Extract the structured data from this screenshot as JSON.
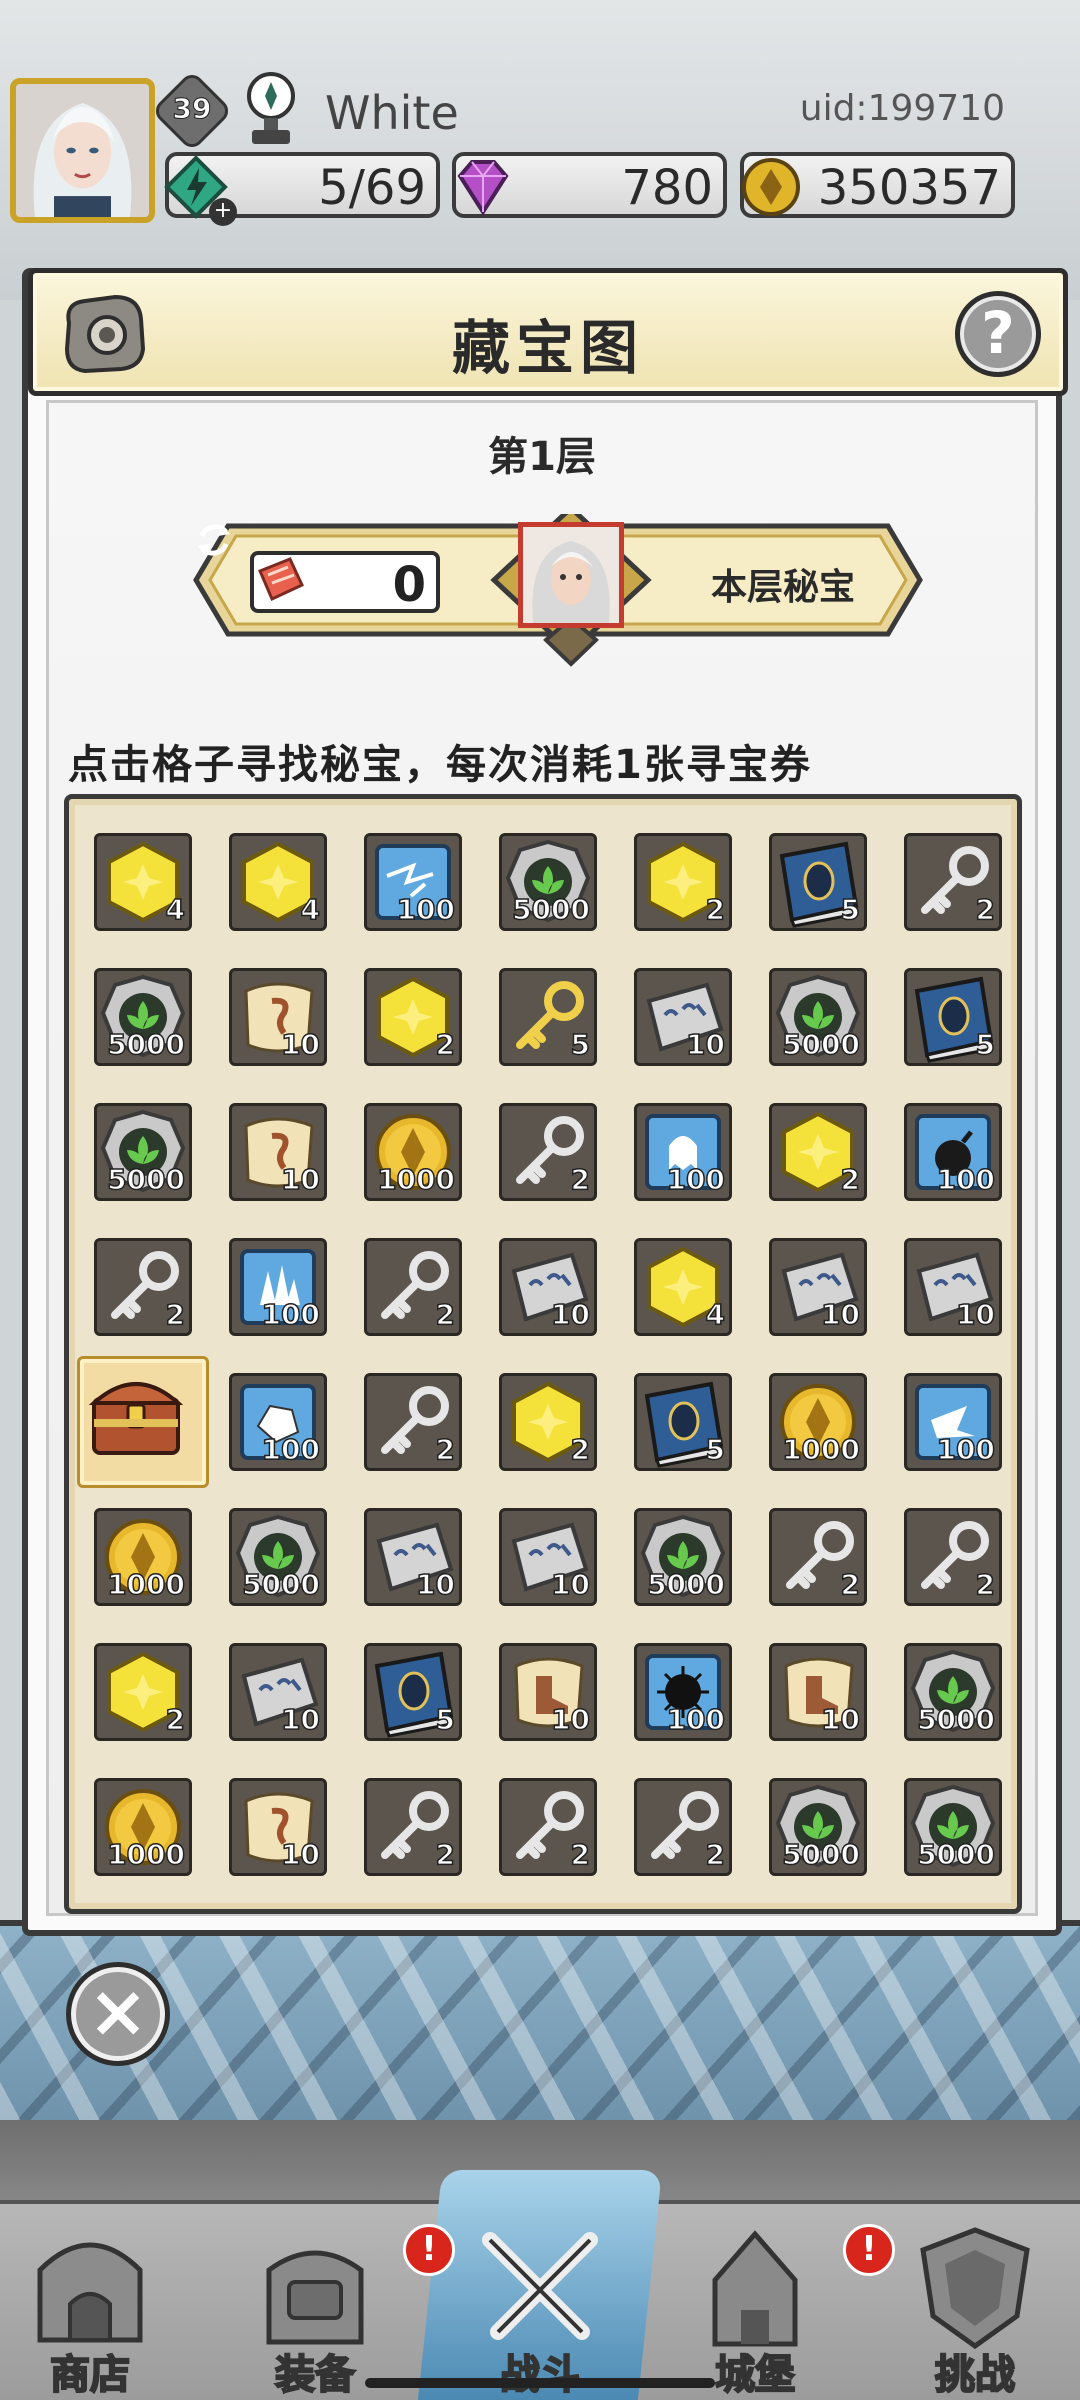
{
  "hud": {
    "level": "39",
    "player_name": "White",
    "uid": "uid:199710",
    "energy": "5/69",
    "gems": "780",
    "gold": "350357"
  },
  "panel": {
    "title": "藏宝图",
    "help": "?",
    "floor": "第1层",
    "ticket_count": "0",
    "secret_label": "本层秘宝",
    "instruction": "点击格子寻找秘宝，每次消耗1张寻宝券"
  },
  "grid": {
    "rows": [
      [
        {
          "item": "gold-hex-icon",
          "qty": "4"
        },
        {
          "item": "gold-hex-icon",
          "qty": "4"
        },
        {
          "item": "blue-lightning-icon",
          "qty": "100"
        },
        {
          "item": "green-leaf-orb-icon",
          "qty": "5000"
        },
        {
          "item": "gold-hex-icon",
          "qty": "2"
        },
        {
          "item": "spell-book-icon",
          "qty": "5"
        },
        {
          "item": "silver-key-icon",
          "qty": "2"
        }
      ],
      [
        {
          "item": "green-leaf-orb-icon",
          "qty": "5000"
        },
        {
          "item": "scroll-icon",
          "qty": "10"
        },
        {
          "item": "gold-hex-icon",
          "qty": "2"
        },
        {
          "item": "gold-key-icon",
          "qty": "5"
        },
        {
          "item": "stone-tablet-icon",
          "qty": "10"
        },
        {
          "item": "green-leaf-orb-icon",
          "qty": "5000"
        },
        {
          "item": "spell-book-icon",
          "qty": "5"
        }
      ],
      [
        {
          "item": "green-leaf-orb-icon",
          "qty": "5000"
        },
        {
          "item": "scroll-icon",
          "qty": "10"
        },
        {
          "item": "gold-coin-icon",
          "qty": "1000"
        },
        {
          "item": "silver-key-icon",
          "qty": "2"
        },
        {
          "item": "blue-ghost-icon",
          "qty": "100"
        },
        {
          "item": "gold-hex-icon",
          "qty": "2"
        },
        {
          "item": "blue-bomb-icon",
          "qty": "100"
        }
      ],
      [
        {
          "item": "silver-key-icon",
          "qty": "2"
        },
        {
          "item": "blue-crystal-icon",
          "qty": "100"
        },
        {
          "item": "silver-key-icon",
          "qty": "2"
        },
        {
          "item": "stone-tablet-icon",
          "qty": "10"
        },
        {
          "item": "gold-hex-icon",
          "qty": "4"
        },
        {
          "item": "stone-tablet-icon",
          "qty": "10"
        },
        {
          "item": "stone-tablet-icon",
          "qty": "10"
        }
      ],
      [
        {
          "item": "treasure-chest-icon",
          "qty": ""
        },
        {
          "item": "blue-rock-icon",
          "qty": "100"
        },
        {
          "item": "silver-key-icon",
          "qty": "2"
        },
        {
          "item": "gold-hex-icon",
          "qty": "2"
        },
        {
          "item": "spell-book-icon",
          "qty": "5"
        },
        {
          "item": "gold-coin-icon",
          "qty": "1000"
        },
        {
          "item": "blue-shard-icon",
          "qty": "100"
        }
      ],
      [
        {
          "item": "gold-coin-icon",
          "qty": "1000"
        },
        {
          "item": "green-leaf-orb-icon",
          "qty": "5000"
        },
        {
          "item": "stone-tablet-icon",
          "qty": "10"
        },
        {
          "item": "stone-tablet-icon",
          "qty": "10"
        },
        {
          "item": "green-leaf-orb-icon",
          "qty": "5000"
        },
        {
          "item": "silver-key-icon",
          "qty": "2"
        },
        {
          "item": "silver-key-icon",
          "qty": "2"
        }
      ],
      [
        {
          "item": "gold-hex-icon",
          "qty": "2"
        },
        {
          "item": "stone-tablet-icon",
          "qty": "10"
        },
        {
          "item": "spell-book-icon",
          "qty": "5"
        },
        {
          "item": "boots-scroll-icon",
          "qty": "10"
        },
        {
          "item": "blue-burst-icon",
          "qty": "100"
        },
        {
          "item": "boots-scroll-icon",
          "qty": "10"
        },
        {
          "item": "green-leaf-orb-icon",
          "qty": "5000"
        }
      ],
      [
        {
          "item": "gold-coin-icon",
          "qty": "1000"
        },
        {
          "item": "scroll-icon",
          "qty": "10"
        },
        {
          "item": "silver-key-icon",
          "qty": "2"
        },
        {
          "item": "silver-key-icon",
          "qty": "2"
        },
        {
          "item": "silver-key-icon",
          "qty": "2"
        },
        {
          "item": "green-leaf-orb-icon",
          "qty": "5000"
        },
        {
          "item": "green-leaf-orb-icon",
          "qty": "5000"
        }
      ]
    ]
  },
  "nav": {
    "items": [
      {
        "label": "商店",
        "icon": "shop-icon",
        "badge": ""
      },
      {
        "label": "装备",
        "icon": "backpack-icon",
        "badge": "!"
      },
      {
        "label": "战斗",
        "icon": "crossed-swords-icon",
        "badge": ""
      },
      {
        "label": "城堡",
        "icon": "castle-icon",
        "badge": "!"
      },
      {
        "label": "挑战",
        "icon": "shield-icon",
        "badge": ""
      }
    ]
  },
  "colors": {
    "panel_header": "#efe3b2",
    "grid_bg": "#ece4cc",
    "cell_bg": "#5b554d",
    "badge_red": "#d8261d",
    "gold": "#c9a227"
  }
}
